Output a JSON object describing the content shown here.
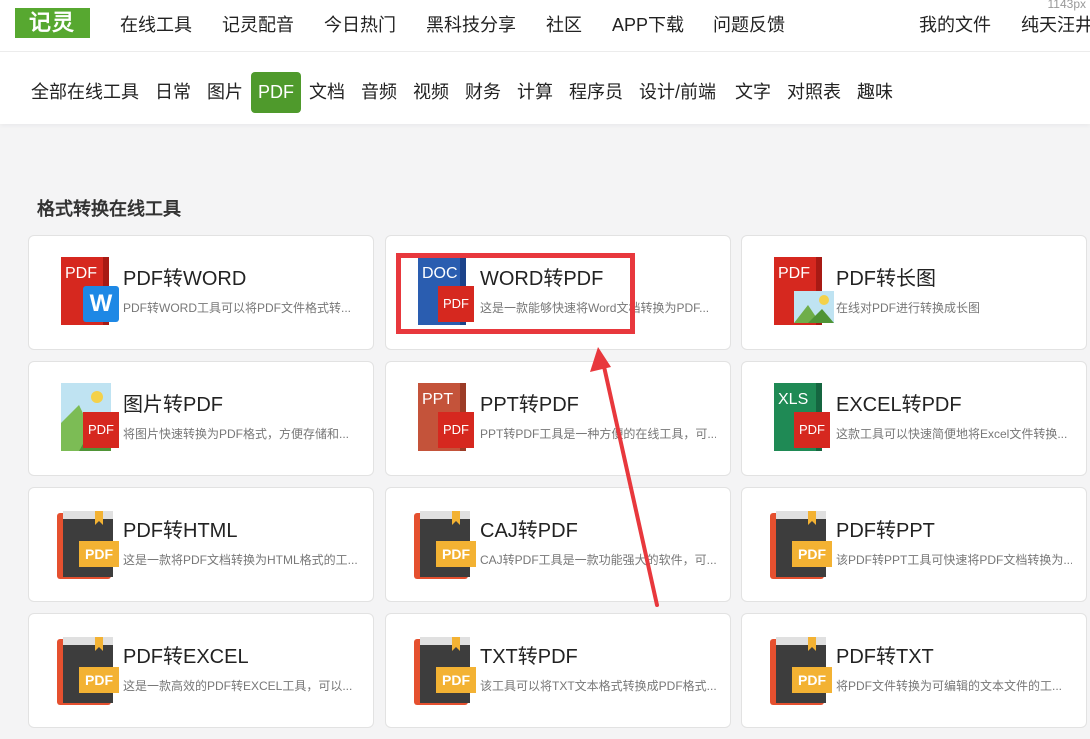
{
  "header": {
    "logo": "记灵",
    "nav": [
      "在线工具",
      "记灵配音",
      "今日热门",
      "黑科技分享",
      "社区",
      "APP下载",
      "问题反馈"
    ],
    "my_files": "我的文件",
    "user": "纯天汪井",
    "resize_hint": "1143px"
  },
  "categories": [
    "全部在线工具",
    "日常",
    "图片",
    "PDF",
    "文档",
    "音频",
    "视频",
    "财务",
    "计算",
    "程序员",
    "设计/前端",
    "文字",
    "对照表",
    "趣味"
  ],
  "active_category": "PDF",
  "section_title": "格式转换在线工具",
  "tools": [
    {
      "title": "PDF转WORD",
      "desc": "PDF转WORD工具可以将PDF文件格式转...",
      "icon": "pdf-to-word-icon",
      "icon_label": "PDF",
      "badge": "W"
    },
    {
      "title": "WORD转PDF",
      "desc": "这是一款能够快速将Word文档转换为PDF...",
      "icon": "word-to-pdf-icon",
      "icon_label": "DOC",
      "badge": "PDF"
    },
    {
      "title": "PDF转长图",
      "desc": "在线对PDF进行转换成长图",
      "icon": "pdf-to-image-icon",
      "icon_label": "PDF",
      "badge": ""
    },
    {
      "title": "图片转PDF",
      "desc": "将图片快速转换为PDF格式，方便存储和...",
      "icon": "image-to-pdf-icon",
      "icon_label": "",
      "badge": "PDF"
    },
    {
      "title": "PPT转PDF",
      "desc": "PPT转PDF工具是一种方便的在线工具，可...",
      "icon": "ppt-to-pdf-icon",
      "icon_label": "PPT",
      "badge": "PDF"
    },
    {
      "title": "EXCEL转PDF",
      "desc": "这款工具可以快速简便地将Excel文件转换...",
      "icon": "excel-to-pdf-icon",
      "icon_label": "XLS",
      "badge": "PDF"
    },
    {
      "title": "PDF转HTML",
      "desc": "这是一款将PDF文档转换为HTML格式的工...",
      "icon": "pdf-book-icon",
      "icon_label": "",
      "badge": "PDF"
    },
    {
      "title": "CAJ转PDF",
      "desc": "CAJ转PDF工具是一款功能强大的软件，可...",
      "icon": "pdf-book-icon",
      "icon_label": "",
      "badge": "PDF"
    },
    {
      "title": "PDF转PPT",
      "desc": "该PDF转PPT工具可快速将PDF文档转换为...",
      "icon": "pdf-book-icon",
      "icon_label": "",
      "badge": "PDF"
    },
    {
      "title": "PDF转EXCEL",
      "desc": "这是一款高效的PDF转EXCEL工具，可以...",
      "icon": "pdf-book-icon",
      "icon_label": "",
      "badge": "PDF"
    },
    {
      "title": "TXT转PDF",
      "desc": "该工具可以将TXT文本格式转换成PDF格式...",
      "icon": "pdf-book-icon",
      "icon_label": "",
      "badge": "PDF"
    },
    {
      "title": "PDF转TXT",
      "desc": "将PDF文件转换为可编辑的文本文件的工...",
      "icon": "pdf-book-icon",
      "icon_label": "",
      "badge": "PDF"
    }
  ],
  "colors": {
    "brand_green": "#57a830",
    "active_tab": "#4f9a2c",
    "annotation_red": "#e8383d",
    "pdf_red": "#d6281f",
    "word_blue": "#2a5db0"
  }
}
